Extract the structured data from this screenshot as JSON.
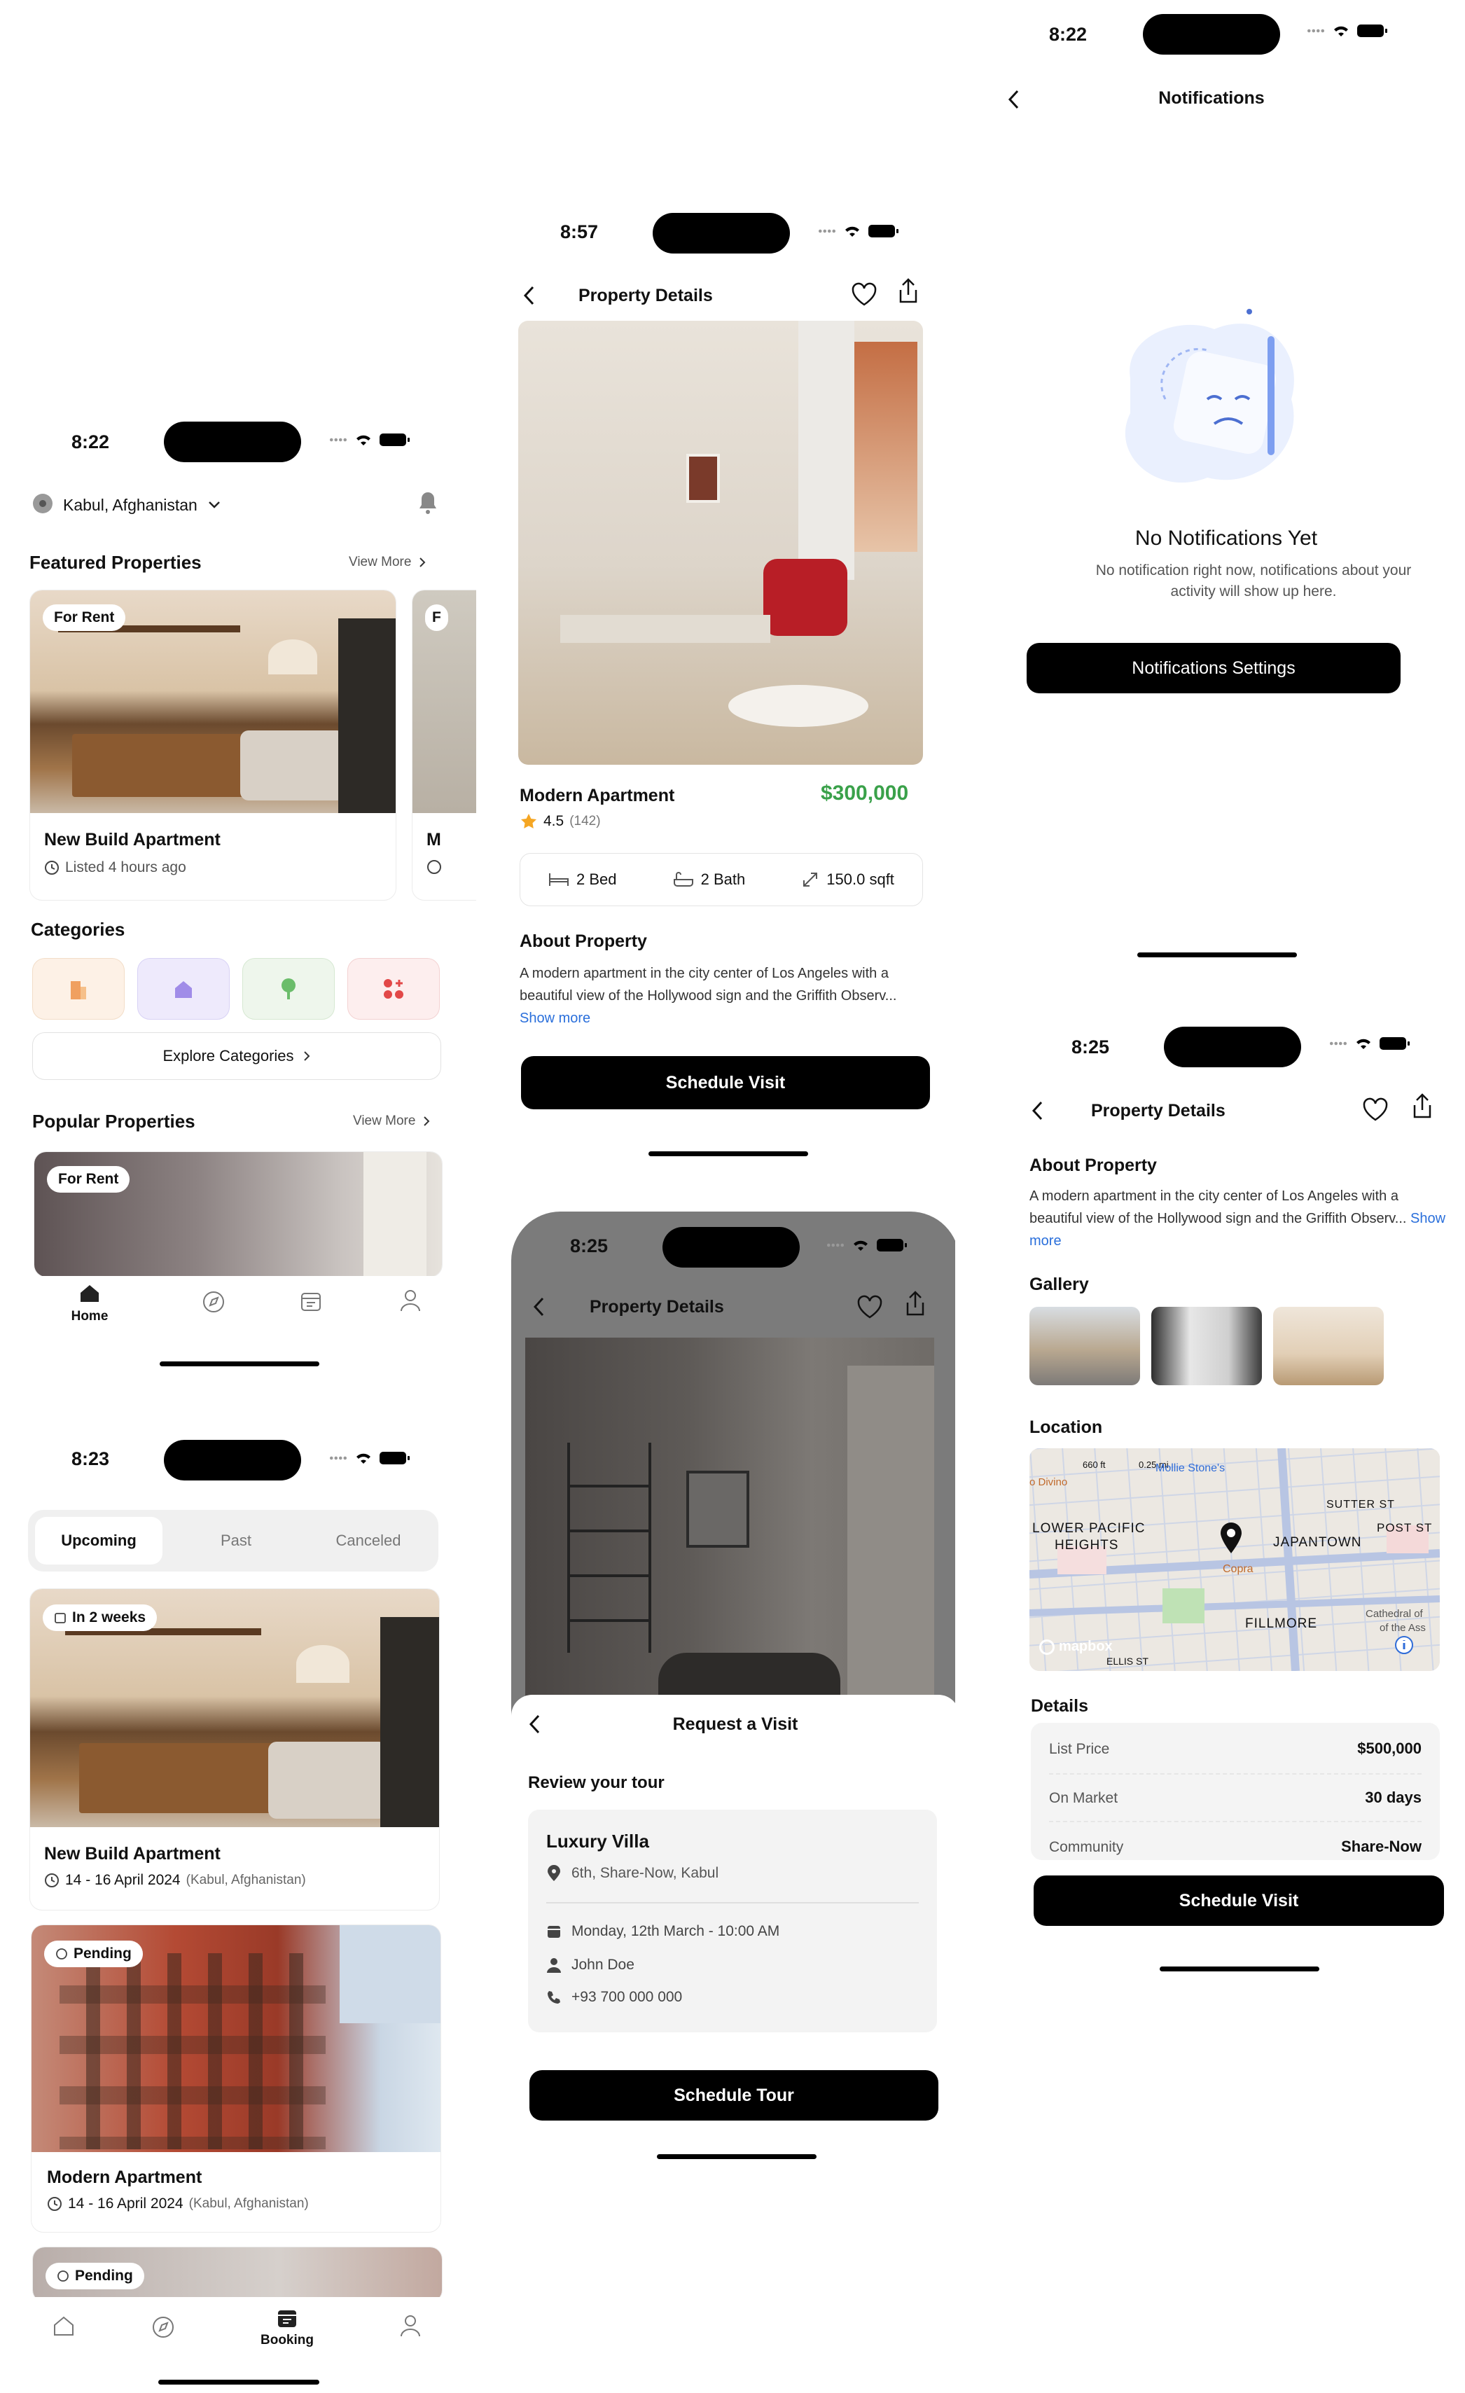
{
  "home": {
    "time": "8:22",
    "location": "Kabul, Afghanistan",
    "featured_title": "Featured Properties",
    "view_more": "View More",
    "featured_badge": "For Rent",
    "featured_badge_2": "F",
    "featured_name": "New Build Apartment",
    "featured_name_2": "M",
    "featured_listed": "Listed 4 hours ago",
    "categories_title": "Categories",
    "explore_categories": "Explore Categories",
    "popular_title": "Popular Properties",
    "popular_view_more": "View More",
    "popular_badge": "For Rent",
    "nav_home": "Home"
  },
  "bookings": {
    "time": "8:23",
    "tabs": [
      "Upcoming",
      "Past",
      "Canceled"
    ],
    "items": [
      {
        "badge": "In 2 weeks",
        "name": "New Build Apartment",
        "dates": "14 - 16 April 2024",
        "place": "(Kabul, Afghanistan)"
      },
      {
        "badge": "Pending",
        "name": "Modern Apartment",
        "dates": "14 - 16 April 2024",
        "place": "(Kabul, Afghanistan)"
      },
      {
        "badge": "Pending"
      }
    ],
    "nav_booking": "Booking"
  },
  "details": {
    "time": "8:57",
    "title": "Property Details",
    "name": "Modern Apartment",
    "price": "$300,000",
    "rating": "4.5",
    "reviews": "(142)",
    "bed": "2 Bed",
    "bath": "2 Bath",
    "area": "150.0 sqft",
    "about_title": "About Property",
    "about_text": "A modern apartment in the city center of Los Angeles with a beautiful view of the Hollywood sign and the Griffith Observ...",
    "show_more": "Show more",
    "cta": "Schedule Visit"
  },
  "request": {
    "time": "8:25",
    "bg_title": "Property Details",
    "sheet_title": "Request a Visit",
    "review_title": "Review your tour",
    "property": "Luxury Villa",
    "address": "6th, Share-Now, Kabul",
    "datetime": "Monday, 12th March - 10:00 AM",
    "person": "John Doe",
    "phone": "+93 700 000 000",
    "cta": "Schedule Tour"
  },
  "notifications": {
    "time": "8:22",
    "title": "Notifications",
    "empty_title": "No Notifications Yet",
    "empty_text": "No notification right now, notifications about your activity will show up here.",
    "cta": "Notifications Settings"
  },
  "details2": {
    "time": "8:25",
    "title": "Property Details",
    "about_title": "About Property",
    "about_text": "A modern apartment in the city center of Los Angeles with a beautiful view of the Hollywood sign and the Griffith Observ...",
    "show_more": "Show more",
    "gallery_title": "Gallery",
    "location_title": "Location",
    "map_labels": {
      "divino": "o Divino",
      "scale1": "660 ft",
      "scale2": "0.25 mi",
      "mollie": "Mollie Stone's",
      "sutter": "SUTTER ST",
      "post": "POST ST",
      "lph": "LOWER PACIFIC",
      "heights": "HEIGHTS",
      "japantown": "JAPANTOWN",
      "copra": "Copra",
      "fillmore": "FILLMORE",
      "cathedral": "Cathedral of",
      "ofthe": "of the Ass",
      "mapbox": "mapbox",
      "ellis": "ELLIS ST"
    },
    "details_title": "Details",
    "rows": [
      {
        "label": "List Price",
        "value": "$500,000"
      },
      {
        "label": "On Market",
        "value": "30 days"
      },
      {
        "label": "Community",
        "value": "Share-Now"
      }
    ],
    "cta": "Schedule Visit"
  },
  "colors": {
    "price_green": "#3aa14a",
    "link_blue": "#2a6fdb",
    "star": "#f5a623"
  }
}
